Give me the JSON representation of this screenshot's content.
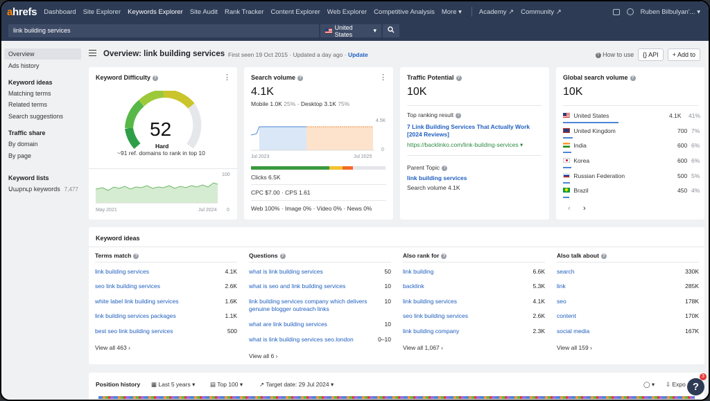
{
  "brand": {
    "logo_a": "a",
    "logo_rest": "hrefs"
  },
  "nav": {
    "items": [
      "Dashboard",
      "Site Explorer",
      "Keywords Explorer",
      "Site Audit",
      "Rank Tracker",
      "Content Explorer",
      "Web Explorer",
      "Competitive Analysis",
      "More"
    ],
    "academy": "Academy",
    "community": "Community",
    "user": "Ruben Bilbulyan'..."
  },
  "search": {
    "query": "link building services",
    "country": "United States"
  },
  "sidebar": {
    "overview": "Overview",
    "ads_history": "Ads history",
    "keyword_ideas_head": "Keyword ideas",
    "matching_terms": "Matching terms",
    "related_terms": "Related terms",
    "search_suggestions": "Search suggestions",
    "traffic_share_head": "Traffic share",
    "by_domain": "By domain",
    "by_page": "By page",
    "keyword_lists_head": "Keyword lists",
    "list_name": "Սաpnւp keywords",
    "list_count": "7,477"
  },
  "header": {
    "title": "Overview: link building services",
    "first_seen": "First seen 19 Oct 2015",
    "updated": "Updated a day ago",
    "update_link": "Update",
    "how_to_use": "How to use",
    "api": "API",
    "add_to": "Add to"
  },
  "kd": {
    "title": "Keyword Difficulty",
    "value": "52",
    "label": "Hard",
    "note": "~91 ref. domains to rank in top 10",
    "score": 52,
    "chart_y_top": "100",
    "chart_y_bottom": "0",
    "chart_x_left": "May 2021",
    "chart_x_right": "Jul 2024"
  },
  "sv": {
    "title": "Search volume",
    "value": "4.1K",
    "mobile": "Mobile 1.0K",
    "mobile_pct": "25%",
    "desktop": "Desktop 3.1K",
    "desktop_pct": "75%",
    "chart_y_top": "4.5K",
    "chart_y_bottom": "0",
    "chart_x_left": "Jul 2023",
    "chart_x_right": "Jul 2025",
    "clicks": "Clicks 6.5K",
    "cpc": "CPC $7.00",
    "cps": "CPS 1.61",
    "serp_features": "Web 100% · Image 0% · Video 0% · News 0%"
  },
  "tp": {
    "title": "Traffic Potential",
    "value": "10K",
    "top_result_label": "Top ranking result",
    "top_result_title": "7 Link Building Services That Actually Work [2024 Reviews]",
    "top_result_url": "https://backlinko.com/link-building-services",
    "parent_label": "Parent Topic",
    "parent_topic": "link building services",
    "parent_volume": "Search volume 4.1K"
  },
  "gsv": {
    "title": "Global search volume",
    "value": "10K",
    "countries": [
      {
        "name": "United States",
        "value": "4.1K",
        "pct": "41%"
      },
      {
        "name": "United Kingdom",
        "value": "700",
        "pct": "7%"
      },
      {
        "name": "India",
        "value": "600",
        "pct": "6%"
      },
      {
        "name": "Korea",
        "value": "600",
        "pct": "6%"
      },
      {
        "name": "Russian Federation",
        "value": "500",
        "pct": "5%"
      },
      {
        "name": "Brazil",
        "value": "450",
        "pct": "4%"
      }
    ]
  },
  "ideas": {
    "title": "Keyword ideas",
    "terms_match": {
      "head": "Terms match",
      "rows": [
        {
          "k": "link building services",
          "v": "4.1K"
        },
        {
          "k": "seo link building services",
          "v": "2.6K"
        },
        {
          "k": "white label link building services",
          "v": "1.6K"
        },
        {
          "k": "link building services packages",
          "v": "1.1K"
        },
        {
          "k": "best seo link building services",
          "v": "500"
        }
      ],
      "view_all": "View all 463"
    },
    "questions": {
      "head": "Questions",
      "rows": [
        {
          "k": "what is link building services",
          "v": "50"
        },
        {
          "k": "what is seo and link building services",
          "v": "10"
        },
        {
          "k": "link building services company which delivers genuine blogger outreach links",
          "v": "10"
        },
        {
          "k": "what are link building services",
          "v": "10"
        },
        {
          "k": "what is link building services seo.london",
          "v": "0–10"
        }
      ],
      "view_all": "View all 6"
    },
    "also_rank": {
      "head": "Also rank for",
      "rows": [
        {
          "k": "link building",
          "v": "6.6K"
        },
        {
          "k": "backlink",
          "v": "5.3K"
        },
        {
          "k": "link building services",
          "v": "4.1K"
        },
        {
          "k": "seo link building services",
          "v": "2.6K"
        },
        {
          "k": "link building company",
          "v": "2.3K"
        }
      ],
      "view_all": "View all 1,067"
    },
    "also_talk": {
      "head": "Also talk about",
      "rows": [
        {
          "k": "search",
          "v": "330K"
        },
        {
          "k": "link",
          "v": "285K"
        },
        {
          "k": "seo",
          "v": "178K"
        },
        {
          "k": "content",
          "v": "170K"
        },
        {
          "k": "social media",
          "v": "167K"
        }
      ],
      "view_all": "View all 159"
    }
  },
  "position": {
    "title": "Position history",
    "period": "Last 5 years",
    "top": "Top 100",
    "target": "Target date: 29 Jul 2024",
    "export": "Expo",
    "help": "?",
    "help_badge": "3"
  },
  "colors": {
    "nav_bg": "#2d3b55",
    "link": "#1f5fbf",
    "accent_orange": "#ff8800"
  }
}
